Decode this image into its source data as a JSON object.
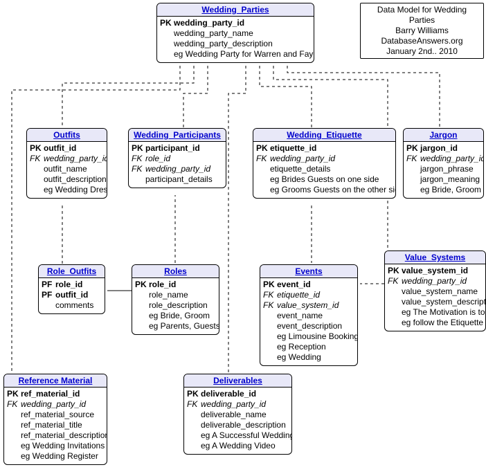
{
  "info_box": {
    "line1": "Data Model for Wedding Parties",
    "line2": "Barry Williams",
    "line3": "DatabaseAnswers.org",
    "line4": "January 2nd.. 2010"
  },
  "entities": {
    "wedding_parties": {
      "title": "Wedding_Parties",
      "rows": [
        {
          "key": "PK",
          "name": "wedding_party_id",
          "pk": true
        },
        {
          "key": "",
          "name": "wedding_party_name"
        },
        {
          "key": "",
          "name": "wedding_party_description"
        },
        {
          "key": "",
          "name": "eg Wedding Party for Warren and Faye"
        }
      ]
    },
    "outfits": {
      "title": "Outfits",
      "rows": [
        {
          "key": "PK",
          "name": "outfit_id",
          "pk": true
        },
        {
          "key": "FK",
          "name": "wedding_party_id",
          "fk": true
        },
        {
          "key": "",
          "name": "outfit_name"
        },
        {
          "key": "",
          "name": "outfit_description"
        },
        {
          "key": "",
          "name": "eg Wedding Dress"
        }
      ]
    },
    "wedding_participants": {
      "title": "Wedding_Participants",
      "rows": [
        {
          "key": "PK",
          "name": "participant_id",
          "pk": true
        },
        {
          "key": "FK",
          "name": "role_id",
          "fk": true
        },
        {
          "key": "FK",
          "name": "wedding_party_id",
          "fk": true
        },
        {
          "key": "",
          "name": "participant_details"
        }
      ]
    },
    "wedding_etiquette": {
      "title": "Wedding_Etiquette",
      "rows": [
        {
          "key": "PK",
          "name": "etiquette_id",
          "pk": true
        },
        {
          "key": "FK",
          "name": "wedding_party_id",
          "fk": true
        },
        {
          "key": "",
          "name": "etiquette_details"
        },
        {
          "key": "",
          "name": "eg Brides Guests on one side"
        },
        {
          "key": "",
          "name": "eg Grooms Guests on the other side"
        }
      ]
    },
    "jargon": {
      "title": "Jargon",
      "rows": [
        {
          "key": "PK",
          "name": "jargon_id",
          "pk": true
        },
        {
          "key": "FK",
          "name": "wedding_party_id",
          "fk": true
        },
        {
          "key": "",
          "name": "jargon_phrase"
        },
        {
          "key": "",
          "name": "jargon_meaning"
        },
        {
          "key": "",
          "name": "eg Bride, Groom"
        }
      ]
    },
    "role_outfits": {
      "title": "Role_Outfits",
      "rows": [
        {
          "key": "PF",
          "name": "role_id",
          "pk": true
        },
        {
          "key": "PF",
          "name": "outfit_id",
          "pk": true
        },
        {
          "key": "",
          "name": "comments"
        }
      ]
    },
    "roles": {
      "title": "Roles",
      "rows": [
        {
          "key": "PK",
          "name": "role_id",
          "pk": true
        },
        {
          "key": "",
          "name": "role_name"
        },
        {
          "key": "",
          "name": "role_description"
        },
        {
          "key": "",
          "name": "eg Bride, Groom"
        },
        {
          "key": "",
          "name": "eg Parents, Guests"
        }
      ]
    },
    "events": {
      "title": "Events",
      "rows": [
        {
          "key": "PK",
          "name": "event_id",
          "pk": true
        },
        {
          "key": "FK",
          "name": "etiquette_id",
          "fk": true
        },
        {
          "key": "FK",
          "name": "value_system_id",
          "fk": true
        },
        {
          "key": "",
          "name": "event_name"
        },
        {
          "key": "",
          "name": "event_description"
        },
        {
          "key": "",
          "name": "eg Limousine Booking"
        },
        {
          "key": "",
          "name": "eg Reception"
        },
        {
          "key": "",
          "name": "eg Wedding"
        }
      ]
    },
    "value_systems": {
      "title": "Value_Systems",
      "rows": [
        {
          "key": "PK",
          "name": "value_system_id",
          "pk": true
        },
        {
          "key": "FK",
          "name": "wedding_party_id",
          "fk": true
        },
        {
          "key": "",
          "name": "value_system_name"
        },
        {
          "key": "",
          "name": "value_system_description"
        },
        {
          "key": "",
          "name": "eg The Motivation is to"
        },
        {
          "key": "",
          "name": "eg follow the Etiquette"
        }
      ]
    },
    "reference_material": {
      "title": "Reference Material",
      "rows": [
        {
          "key": "PK",
          "name": "ref_material_id",
          "pk": true
        },
        {
          "key": "FK",
          "name": "wedding_party_id",
          "fk": true
        },
        {
          "key": "",
          "name": "ref_material_source"
        },
        {
          "key": "",
          "name": "ref_material_title"
        },
        {
          "key": "",
          "name": "ref_material_description"
        },
        {
          "key": "",
          "name": "eg Wedding Invitations"
        },
        {
          "key": "",
          "name": "eg Wedding Register"
        }
      ]
    },
    "deliverables": {
      "title": "Deliverables",
      "rows": [
        {
          "key": "PK",
          "name": "deliverable_id",
          "pk": true
        },
        {
          "key": "FK",
          "name": "wedding_party_id",
          "fk": true
        },
        {
          "key": "",
          "name": "deliverable_name"
        },
        {
          "key": "",
          "name": "deliverable_description"
        },
        {
          "key": "",
          "name": "eg A Successful Wedding"
        },
        {
          "key": "",
          "name": "eg A Wedding Video"
        }
      ]
    }
  }
}
